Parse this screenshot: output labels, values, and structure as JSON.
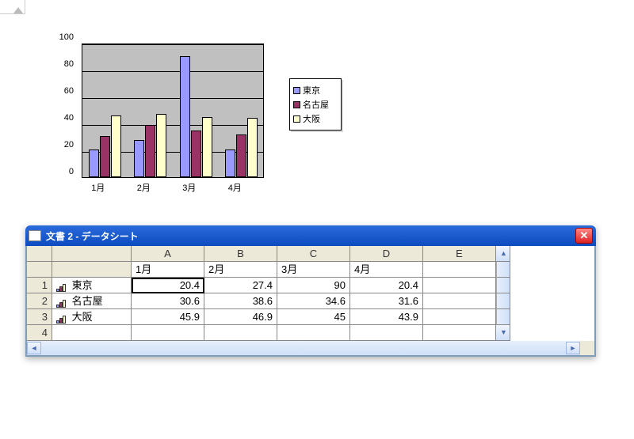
{
  "chart_data": {
    "type": "bar",
    "categories": [
      "1月",
      "2月",
      "3月",
      "4月"
    ],
    "series": [
      {
        "name": "東京",
        "values": [
          20.4,
          27.4,
          90,
          20.4
        ],
        "color": "#9999ff"
      },
      {
        "name": "名古屋",
        "values": [
          30.6,
          38.6,
          34.6,
          31.6
        ],
        "color": "#993366"
      },
      {
        "name": "大阪",
        "values": [
          45.9,
          46.9,
          45,
          43.9
        ],
        "color": "#ffffcc"
      }
    ],
    "ylim": [
      0,
      100
    ],
    "ystep": 20,
    "title": "",
    "xlabel": "",
    "ylabel": ""
  },
  "datasheet": {
    "window_title": "文書 2 - データシート",
    "columns": [
      "A",
      "B",
      "C",
      "D",
      "E"
    ],
    "month_headers": [
      "1月",
      "2月",
      "3月",
      "4月"
    ],
    "rows": [
      {
        "num": "1",
        "label": "東京",
        "values": [
          "20.4",
          "27.4",
          "90",
          "20.4"
        ]
      },
      {
        "num": "2",
        "label": "名古屋",
        "values": [
          "30.6",
          "38.6",
          "34.6",
          "31.6"
        ]
      },
      {
        "num": "3",
        "label": "大阪",
        "values": [
          "45.9",
          "46.9",
          "45",
          "43.9"
        ]
      }
    ],
    "empty_row_num": "4",
    "selected_cell": "A1"
  },
  "yticks": [
    "0",
    "20",
    "40",
    "60",
    "80",
    "100"
  ]
}
